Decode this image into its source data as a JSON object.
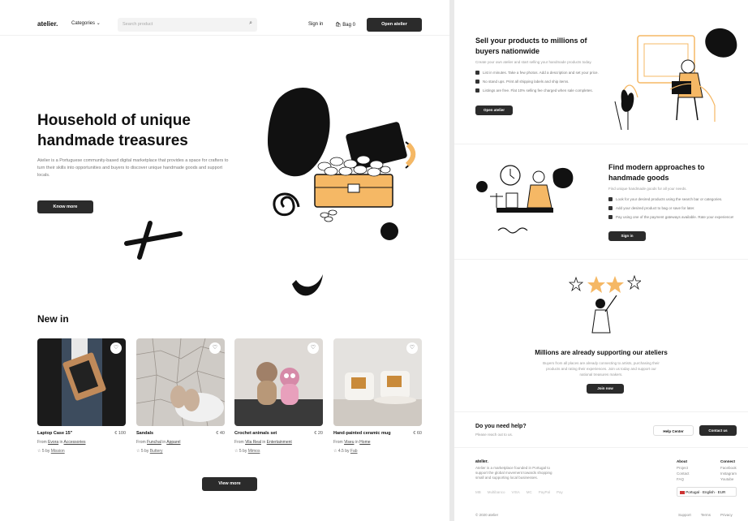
{
  "nav": {
    "logo": "atelier.",
    "categories": "Categories",
    "search_placeholder": "Search product",
    "sign_in": "Sign in",
    "bag": "Bag 0",
    "open_atelier": "Open atelier"
  },
  "hero": {
    "title_line1": "Household of unique",
    "title_line2": "handmade treasures",
    "description": "Atelier is a Portuguese community-based digital marketplace that provides a space for crafters to turn their skills into opportunities and buyers to discover unique handmade goods and support locals.",
    "button": "Know more"
  },
  "new_in": {
    "title": "New in",
    "view_more": "View more",
    "products": [
      {
        "name": "Laptop Case 15\"",
        "price": "€ 100",
        "from_label": "From",
        "shop": "Evora",
        "in_label": "in",
        "category": "Accessories",
        "rating": "5",
        "by_label": "by",
        "reviewer": "Mission"
      },
      {
        "name": "Sandals",
        "price": "€ 40",
        "from_label": "From",
        "shop": "Funchal",
        "in_label": "in",
        "category": "Apparel",
        "rating": "5",
        "by_label": "by",
        "reviewer": "Buttery"
      },
      {
        "name": "Crochet animals set",
        "price": "€ 20",
        "from_label": "From",
        "shop": "Vila Real",
        "in_label": "in",
        "category": "Entertainment",
        "rating": "5",
        "by_label": "by",
        "reviewer": "Mimos"
      },
      {
        "name": "Hand-painted ceramic mug",
        "price": "€ 60",
        "from_label": "From",
        "shop": "Viseu",
        "in_label": "in",
        "category": "Home",
        "rating": "4.5",
        "by_label": "by",
        "reviewer": "Fab"
      }
    ]
  },
  "sell": {
    "title_line1": "Sell your products to millions of",
    "title_line2": "buyers nationwide",
    "subtitle": "Create your own atelier and start selling your handmade products today.",
    "items": [
      "List in minutes. Take a few photos. Add a description and set your price.",
      "No stand ups. Print all shipping labels and ship items.",
      "Listings are free. Flat 10% selling fee charged when sale completes."
    ],
    "button": "Open atelier"
  },
  "find": {
    "title_line1": "Find modern approaches to",
    "title_line2": "handmade goods",
    "subtitle": "Find unique handmade goods for all your needs.",
    "items": [
      "Look for your desired products using the search bar or categories.",
      "Add your desired product to bag or save for later.",
      "Pay using one of the payment gateways available. Rate your experience!"
    ],
    "button": "Sign in"
  },
  "millions": {
    "title": "Millions are already supporting our ateliers",
    "description": "Buyers from all places are already connecting to artists, purchasing their products and rating their experiences. Join us today and support our national treasures makers.",
    "button": "Join now"
  },
  "help": {
    "title": "Do you need help?",
    "subtitle": "Please reach out to us.",
    "help_center": "Help Center",
    "contact": "Contact us"
  },
  "footer": {
    "logo": "atelier.",
    "about_text": "Atelier is a marketplace founded in Portugal to support the global movement towards shopping small and supporting local businesses.",
    "about_col": {
      "title": "About",
      "links": [
        "Project",
        "Contact",
        "FAQ"
      ]
    },
    "connect_col": {
      "title": "Connect",
      "links": [
        "Facebook",
        "Instagram",
        "Youtube"
      ]
    },
    "payments": [
      "MB",
      "Multibanco",
      "VISA",
      "MC",
      "PayPal",
      "Pay"
    ],
    "language": "Portugal · English · EUR",
    "copyright": "© 2020 atelier",
    "bottom_links": [
      "Support",
      "Terms",
      "Privacy"
    ]
  },
  "colors": {
    "accent": "#f5b865",
    "dark": "#2b2b2b"
  }
}
